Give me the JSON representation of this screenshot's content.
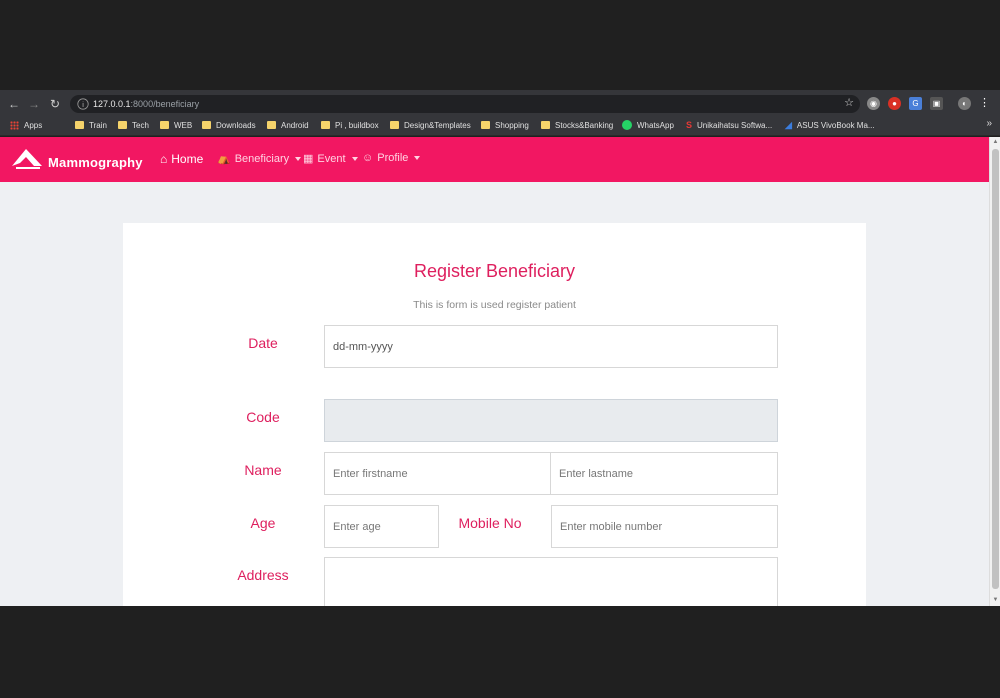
{
  "browser": {
    "url_host": "127.0.0.1",
    "url_rest": ":8000/beneficiary",
    "bookmarks": [
      {
        "label": "Apps",
        "icon": "apps-icon"
      },
      {
        "label": "Train",
        "icon": "folder-icon"
      },
      {
        "label": "Tech",
        "icon": "folder-icon"
      },
      {
        "label": "WEB",
        "icon": "folder-icon"
      },
      {
        "label": "Downloads",
        "icon": "folder-icon"
      },
      {
        "label": "Android",
        "icon": "folder-icon"
      },
      {
        "label": "Pi , buildbox",
        "icon": "folder-icon"
      },
      {
        "label": "Design&Templates",
        "icon": "folder-icon"
      },
      {
        "label": "Shopping",
        "icon": "folder-icon"
      },
      {
        "label": "Stocks&Banking",
        "icon": "folder-icon"
      },
      {
        "label": "WhatsApp",
        "icon": "whatsapp-icon"
      },
      {
        "label": "Unikaihatsu Softwa...",
        "icon": "unikaihatsu-icon"
      },
      {
        "label": "ASUS VivoBook Ma...",
        "icon": "asus-icon"
      }
    ],
    "more_label": "»"
  },
  "navbar": {
    "brand": "Mammography",
    "color": "#f21762",
    "items": [
      {
        "label": "Home",
        "icon": "home-icon"
      },
      {
        "label": "Beneficiary",
        "icon": "bed-icon"
      },
      {
        "label": "Event",
        "icon": "calendar-icon"
      },
      {
        "label": "Profile",
        "icon": "user-circle-icon"
      }
    ]
  },
  "form": {
    "title": "Register Beneficiary",
    "subtitle": "This is form is used register patient",
    "labels": {
      "date": "Date",
      "code": "Code",
      "name": "Name",
      "age": "Age",
      "mobile": "Mobile No",
      "address": "Address"
    },
    "date_value": "dd-mm-yyyy",
    "placeholders": {
      "firstname": "Enter firstname",
      "lastname": "Enter lastname",
      "age": "Enter age",
      "mobile": "Enter mobile number"
    },
    "accent": "#de1f5e"
  }
}
